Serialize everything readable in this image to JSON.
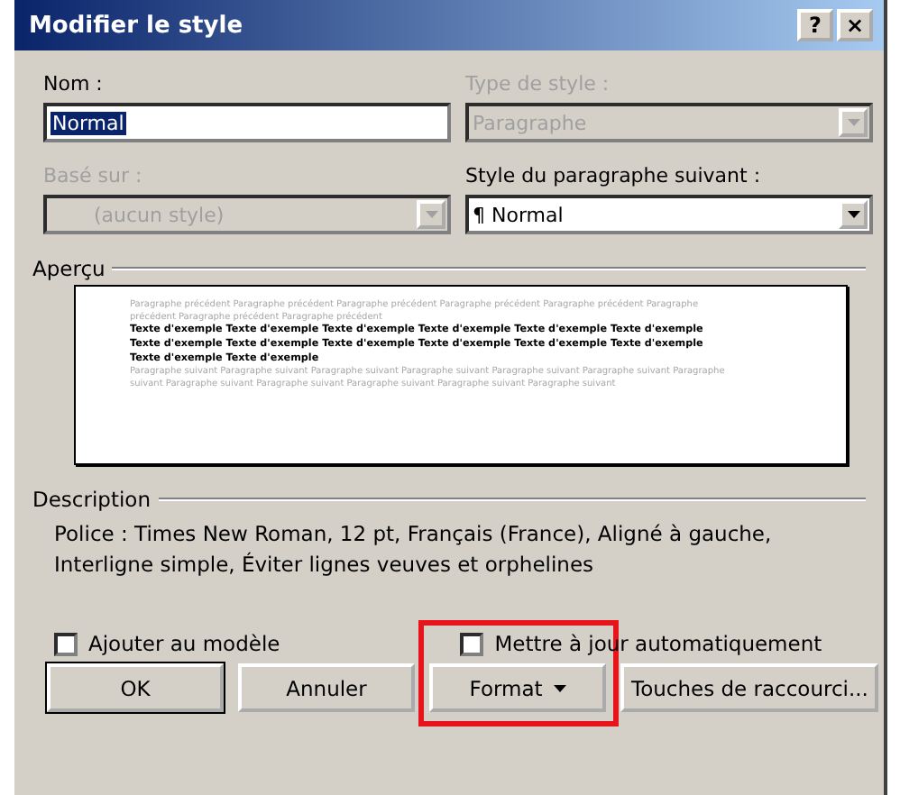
{
  "window": {
    "title": "Modifier le style",
    "help": "?",
    "close": "×"
  },
  "fields": [
    {
      "label": "Nom :",
      "value": "Normal",
      "kind": "text",
      "disabled": false
    },
    {
      "label": "Type de style :",
      "value": "Paragraphe",
      "kind": "combo",
      "disabled": true
    },
    {
      "label": "Basé sur :",
      "value": "(aucun style)",
      "kind": "combo",
      "disabled": true
    },
    {
      "label": "Style du paragraphe suivant :",
      "value": "¶ Normal",
      "kind": "combo",
      "disabled": false
    }
  ],
  "preview": {
    "label": "Aperçu",
    "paragraphs": [
      {
        "kind": "previous",
        "text": "Paragraphe précédent Paragraphe précédent Paragraphe précédent Paragraphe précédent Paragraphe précédent Paragraphe précédent Paragraphe précédent Paragraphe précédent"
      },
      {
        "kind": "sample",
        "text": "Texte d'exemple Texte d'exemple Texte d'exemple Texte d'exemple Texte d'exemple Texte d'exemple Texte d'exemple Texte d'exemple Texte d'exemple Texte d'exemple Texte d'exemple Texte d'exemple Texte d'exemple Texte d'exemple"
      },
      {
        "kind": "next",
        "text": "Paragraphe suivant Paragraphe suivant Paragraphe suivant Paragraphe suivant Paragraphe suivant Paragraphe suivant Paragraphe suivant Paragraphe suivant Paragraphe suivant Paragraphe suivant Paragraphe suivant Paragraphe suivant"
      }
    ]
  },
  "description": {
    "label": "Description",
    "text": "Police : Times New Roman, 12 pt, Français (France), Aligné à gauche, Interligne simple, Éviter lignes veuves et orphelines"
  },
  "checkboxes": [
    {
      "label": "Ajouter au modèle",
      "checked": false
    },
    {
      "label": "Mettre à jour automatiquement",
      "checked": false
    }
  ],
  "buttons": [
    {
      "label": "OK",
      "default": true,
      "menu": false,
      "highlighted": false
    },
    {
      "label": "Annuler",
      "default": false,
      "menu": false,
      "highlighted": false
    },
    {
      "label": "Format",
      "default": false,
      "menu": true,
      "highlighted": true
    },
    {
      "label": "Touches de raccourci...",
      "default": false,
      "menu": false,
      "highlighted": false
    }
  ]
}
